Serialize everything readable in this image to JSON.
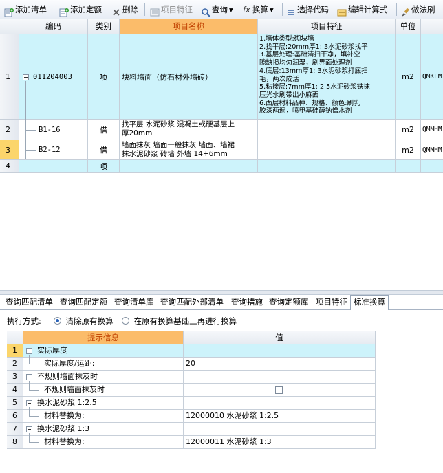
{
  "toolbar": {
    "add_list": "添加清单",
    "add_quota": "添加定额",
    "delete": "删除",
    "item_feature": "项目特征",
    "query": "查询",
    "convert": "换算",
    "select_code": "选择代码",
    "edit_formula": "编辑计算式",
    "method_note": "做法刷"
  },
  "grid1": {
    "headers": {
      "code": "编码",
      "category": "类别",
      "name": "项目名称",
      "feature": "项目特征",
      "unit": "单位"
    },
    "rows": [
      {
        "num": "1",
        "code": "011204003",
        "category": "项",
        "name": "块料墙面（仿石材外墙砖）",
        "feature": "1.墙体类型:砌块墙\n2.找平层:20mm厚1: 3水泥砂浆找平\n3.基层处理:基础清扫干净，填补空\n隙缺损均匀润湿，刷界面处理剂\n4.底层:13mm厚1: 3水泥砂浆打底扫\n毛，两次成活\n5.粘接层:7mm厚1: 2.5水泥砂浆铁抹\n压光水刷带出小麻面\n6.面层材料品种、规格、颜色:刷乳\n胶漆两遍，喷甲基硅醇钠憎水剂",
        "unit": "m2",
        "extra": "QMKLM"
      },
      {
        "num": "2",
        "code": "B1-16",
        "category": "借",
        "name": "找平层 水泥砂浆 混凝土或硬基层上\n厚20mm",
        "feature": "",
        "unit": "m2",
        "extra": "QMMHM"
      },
      {
        "num": "3",
        "code": "B2-12",
        "category": "借",
        "name": "墙面抹灰 墙面一般抹灰 墙面、墙裙\n抹水泥砂浆 砖墙 外墙 14+6mm",
        "feature": "",
        "unit": "m2",
        "extra": "QMMHM"
      },
      {
        "num": "4",
        "code": "",
        "category": "项",
        "name": "",
        "feature": "",
        "unit": "",
        "extra": ""
      }
    ]
  },
  "tabs": [
    "查询匹配清单",
    "查询匹配定额",
    "查询清单库",
    "查询匹配外部清单",
    "查询措施",
    "查询定额库",
    "项目特征",
    "标准换算"
  ],
  "options": {
    "label": "执行方式:",
    "opt1": "清除原有换算",
    "opt2": "在原有换算基础上再进行换算"
  },
  "grid2": {
    "headers": {
      "info": "提示信息",
      "value": "值"
    },
    "rows": [
      {
        "num": "1",
        "label": "实际厚度",
        "value": "",
        "group": true
      },
      {
        "num": "2",
        "label": "实际厚度/运距:",
        "value": "20",
        "group": false
      },
      {
        "num": "3",
        "label": "不规则墙面抹灰时",
        "value": "",
        "group": true
      },
      {
        "num": "4",
        "label": "不规则墙面抹灰时",
        "value": "",
        "group": false,
        "checkbox": true
      },
      {
        "num": "5",
        "label": "换水泥砂浆 1:2.5",
        "value": "",
        "group": true
      },
      {
        "num": "6",
        "label": "材料替换为:",
        "value": "12000010  水泥砂浆 1:2.5",
        "group": false
      },
      {
        "num": "7",
        "label": "换水泥砂浆 1:3",
        "value": "",
        "group": true
      },
      {
        "num": "8",
        "label": "材料替换为:",
        "value": "12000011  水泥砂浆 1:3",
        "group": false
      }
    ]
  }
}
